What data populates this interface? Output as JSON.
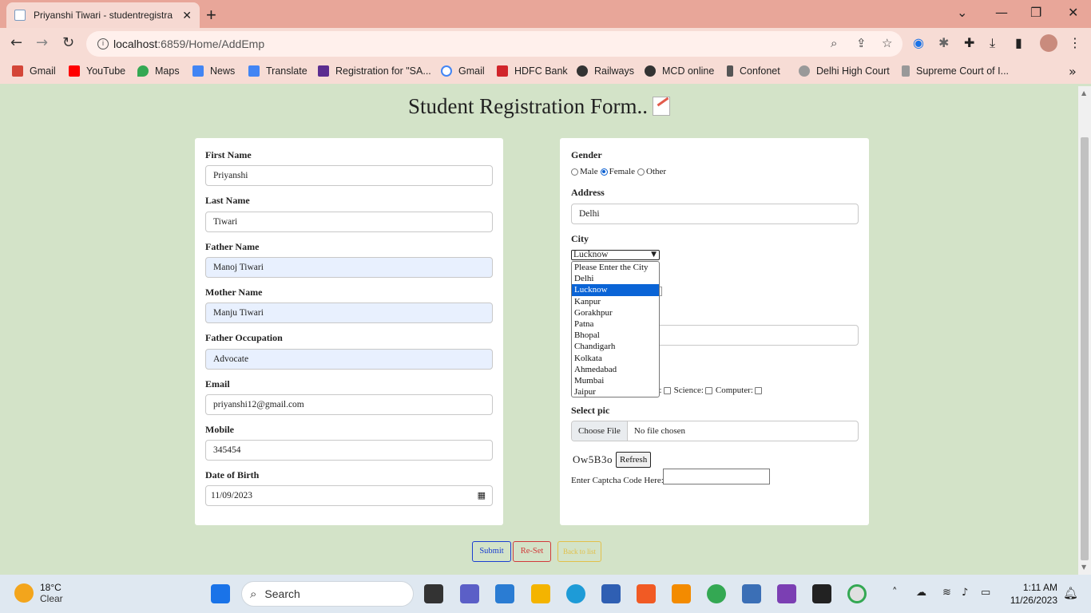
{
  "browser": {
    "tab_title": "Priyanshi Tiwari - studentregistra",
    "url_host": "localhost",
    "url_rest": ":6859/Home/AddEmp",
    "bookmarks": [
      {
        "label": "Gmail",
        "color": "#d44638"
      },
      {
        "label": "YouTube",
        "color": "#ff0000"
      },
      {
        "label": "Maps",
        "color": "#34a853"
      },
      {
        "label": "News",
        "color": "#4285f4"
      },
      {
        "label": "Translate",
        "color": "#4285f4"
      },
      {
        "label": "Registration for \"SA...",
        "color": "#5b2d90"
      },
      {
        "label": "Gmail",
        "color": "#4285f4"
      },
      {
        "label": "HDFC Bank",
        "color": "#d1252b"
      },
      {
        "label": "Railways",
        "color": "#333333"
      },
      {
        "label": "MCD online",
        "color": "#333333"
      },
      {
        "label": "Confonet",
        "color": "#555555"
      },
      {
        "label": "Delhi High Court",
        "color": "#777777"
      },
      {
        "label": "Supreme Court of I...",
        "color": "#777777"
      }
    ]
  },
  "page": {
    "heading": "Student Registration Form..",
    "left": {
      "first_name_label": "First Name",
      "first_name_value": "Priyanshi",
      "last_name_label": "Last Name",
      "last_name_value": "Tiwari",
      "father_name_label": "Father Name",
      "father_name_value": "Manoj Tiwari",
      "mother_name_label": "Mother Name",
      "mother_name_value": "Manju Tiwari",
      "father_occupation_label": "Father Occupation",
      "father_occupation_value": "Advocate",
      "email_label": "Email",
      "email_value": "priyanshi12@gmail.com",
      "mobile_label": "Mobile",
      "mobile_value": "345454",
      "dob_label": "Date of Birth",
      "dob_value": "11/09/2023"
    },
    "right": {
      "gender_label": "Gender",
      "gender_options": [
        "Male",
        "Female",
        "Other"
      ],
      "gender_selected": "Female",
      "address_label": "Address",
      "address_value": "Delhi",
      "city_label": "City",
      "city_selected": "Lucknow",
      "city_options": [
        "Please Enter the City",
        "Delhi",
        "Lucknow",
        "Kanpur",
        "Gorakhpur",
        "Patna",
        "Bhopal",
        "Chandigarh",
        "Kolkata",
        "Ahmedabad",
        "Mumbai",
        "Jaipur"
      ],
      "subjects_partial": "ss:",
      "subject_science": "Science:",
      "subject_computer": "Computer:",
      "select_pic_label": "Select pic",
      "choose_file": "Choose File",
      "no_file": "No file chosen",
      "captcha_code": "Ow5B3o",
      "refresh_label": "Refresh",
      "captcha_prompt": "Enter Captcha Code Here:"
    },
    "buttons": {
      "submit": "Submit",
      "reset": "Re-Set",
      "back": "Back to list"
    }
  },
  "taskbar": {
    "temperature": "18°C",
    "condition": "Clear",
    "search_placeholder": "Search",
    "time": "1:11 AM",
    "date": "11/26/2023"
  }
}
